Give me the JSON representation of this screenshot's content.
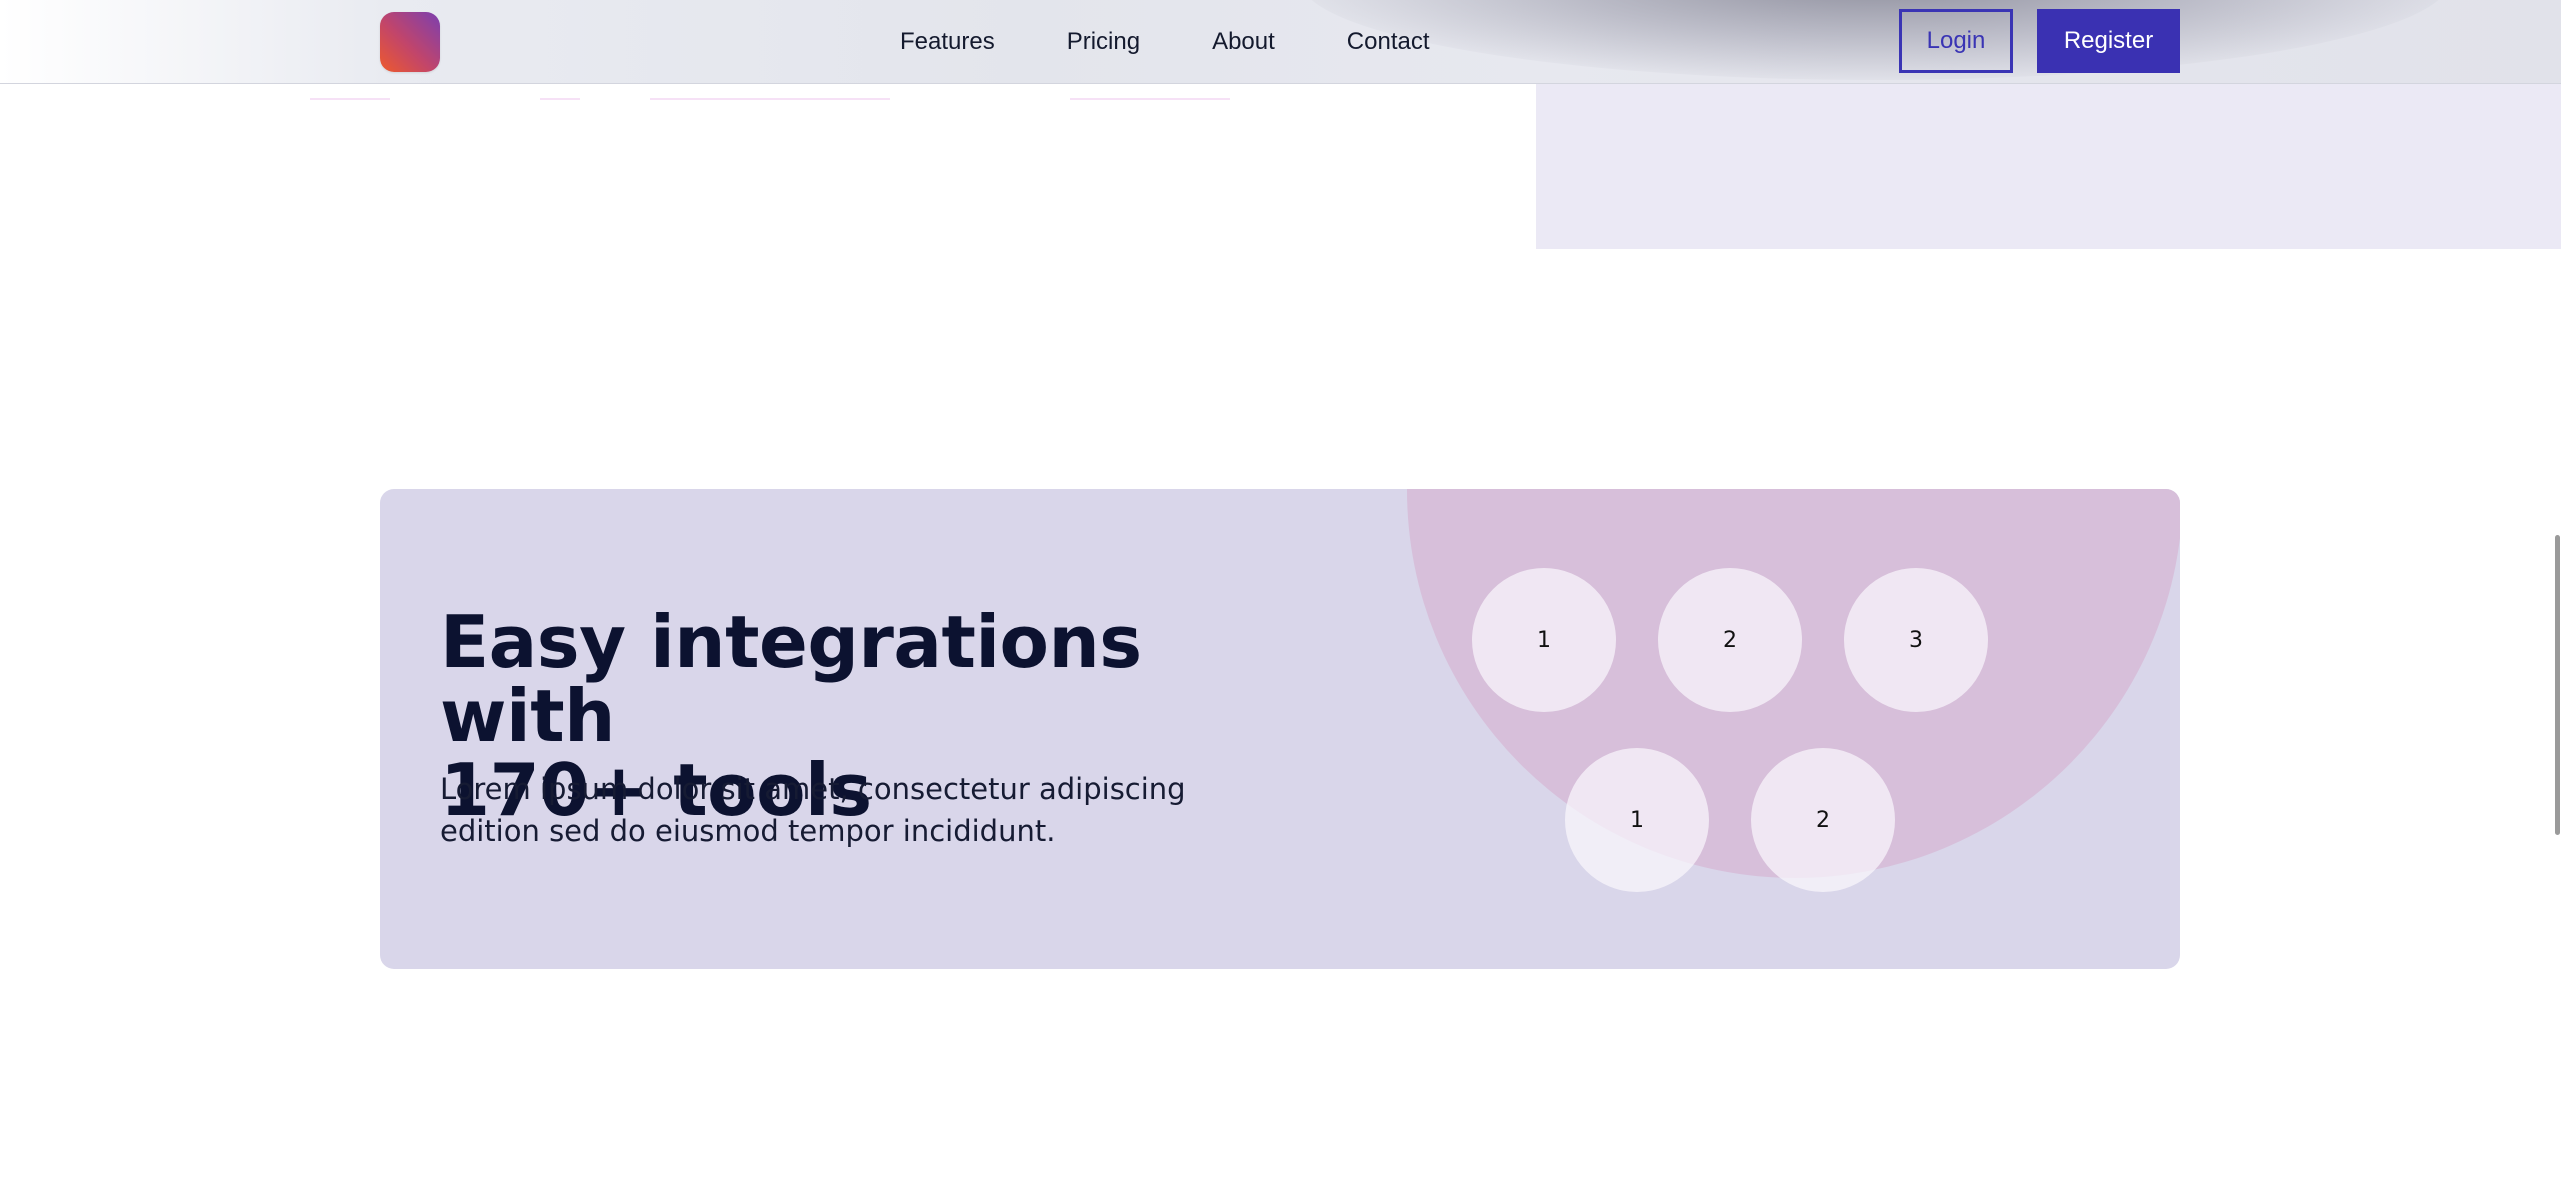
{
  "header": {
    "logo_icon": "app-logo-gradient",
    "nav": [
      {
        "label": "Features"
      },
      {
        "label": "Pricing"
      },
      {
        "label": "About"
      },
      {
        "label": "Contact"
      }
    ],
    "login_label": "Login",
    "register_label": "Register"
  },
  "integrations": {
    "title_line1": "Easy integrations with",
    "title_line2": "170+ tools",
    "description_line1": "Lorem ipsum dolor sit amet, consectetur adipiscing",
    "description_line2": "edition sed do eiusmod tempor incididunt.",
    "tools_row1": [
      "1",
      "2",
      "3"
    ],
    "tools_row2": [
      "1",
      "2"
    ]
  },
  "colors": {
    "accent": "#3a31b2",
    "card_bg": "#d9d6ea",
    "card_circle": "#d7bfda",
    "title": "#0c1230"
  }
}
